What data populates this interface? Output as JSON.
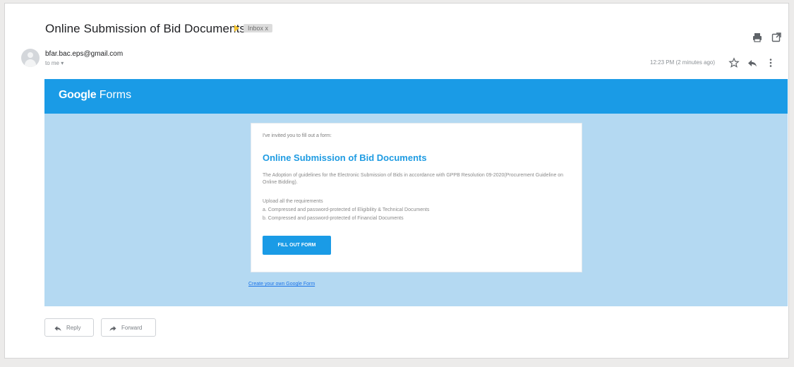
{
  "email": {
    "subject": "Online Submission of Bid Documents",
    "label_chip": "Inbox x",
    "sender_email": "bfar.bac.eps@gmail.com",
    "recipient": "to me",
    "timestamp": "12:23 PM (2 minutes ago)"
  },
  "icons": {
    "print": "printer-icon",
    "new_window": "open-in-new-window-icon",
    "star": "star-icon",
    "reply": "reply-icon",
    "more": "more-vert-icon",
    "forward": "forward-icon"
  },
  "form_banner": {
    "brand_bold": "Google",
    "brand_light": "Forms"
  },
  "form_card": {
    "invite_text": "I've invited you to fill out a form:",
    "title": "Online Submission of Bid Documents",
    "description": "The Adoption of guidelines for the Electronic Submission of Bids in accordance with GPPB Resolution 09-2020(Procurement Guideline on Online Bidding).",
    "requirements_heading": "Upload all the requirements",
    "requirements": [
      "a. Compressed and password-protected of Eligibility & Technical Documents",
      "b. Compressed and password-protected of Financial Documents"
    ],
    "cta_label": "FILL OUT FORM"
  },
  "create_form_link": "Create your own Google Form",
  "actions": {
    "reply_label": "Reply",
    "forward_label": "Forward"
  },
  "colors": {
    "brand_blue": "#1a9be6",
    "panel_blue": "#b4d9f2",
    "title_blue": "#1e9be2",
    "important_marker": "#f4c430"
  }
}
